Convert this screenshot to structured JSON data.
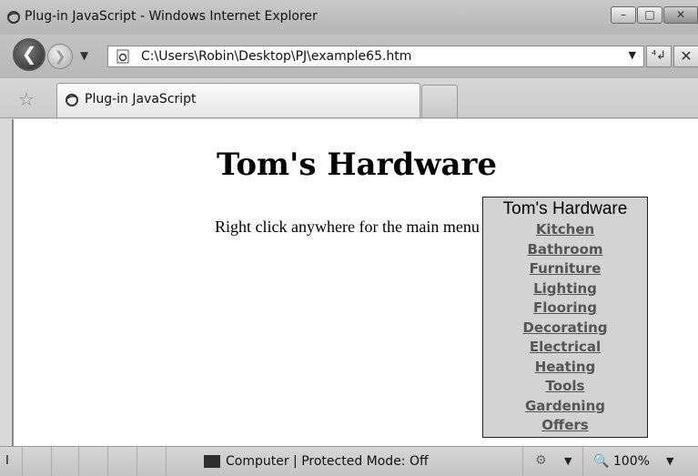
{
  "window": {
    "title": "Plug-in JavaScript - Windows Internet Explorer",
    "buttons": {
      "minimize": "–",
      "maximize": "□",
      "close": "✕"
    }
  },
  "address_bar": {
    "back_glyph": "❮",
    "forward_glyph": "❯",
    "history_drop": "▼",
    "url": "C:\\Users\\Robin\\Desktop\\PJ\\example65.htm",
    "url_drop": "▼",
    "refresh_glyph": "⁴↲",
    "stop_glyph": "✕"
  },
  "tabs": {
    "favorites_icon": "☆",
    "active_tab_title": "Plug-in JavaScript"
  },
  "page": {
    "heading": "Tom's Hardware",
    "instruction": "Right click anywhere for the main menu"
  },
  "context_menu": {
    "title": "Tom's Hardware",
    "items": [
      {
        "label": "Kitchen"
      },
      {
        "label": "Bathroom"
      },
      {
        "label": "Furniture"
      },
      {
        "label": "Lighting"
      },
      {
        "label": "Flooring"
      },
      {
        "label": "Decorating"
      },
      {
        "label": "Electrical"
      },
      {
        "label": "Heating"
      },
      {
        "label": "Tools"
      },
      {
        "label": "Gardening"
      },
      {
        "label": "Offers"
      }
    ]
  },
  "status_bar": {
    "left_text": "I",
    "zone": "Computer | Protected Mode: Off",
    "addon_glyph": "⚙",
    "addon_drop": "▼",
    "zoom": "🔍 100%",
    "zoom_drop": "▼"
  },
  "colors": {
    "menu_bg": "#d3d3d3",
    "menu_link": "#555555",
    "chrome": "#c3c3c3"
  }
}
